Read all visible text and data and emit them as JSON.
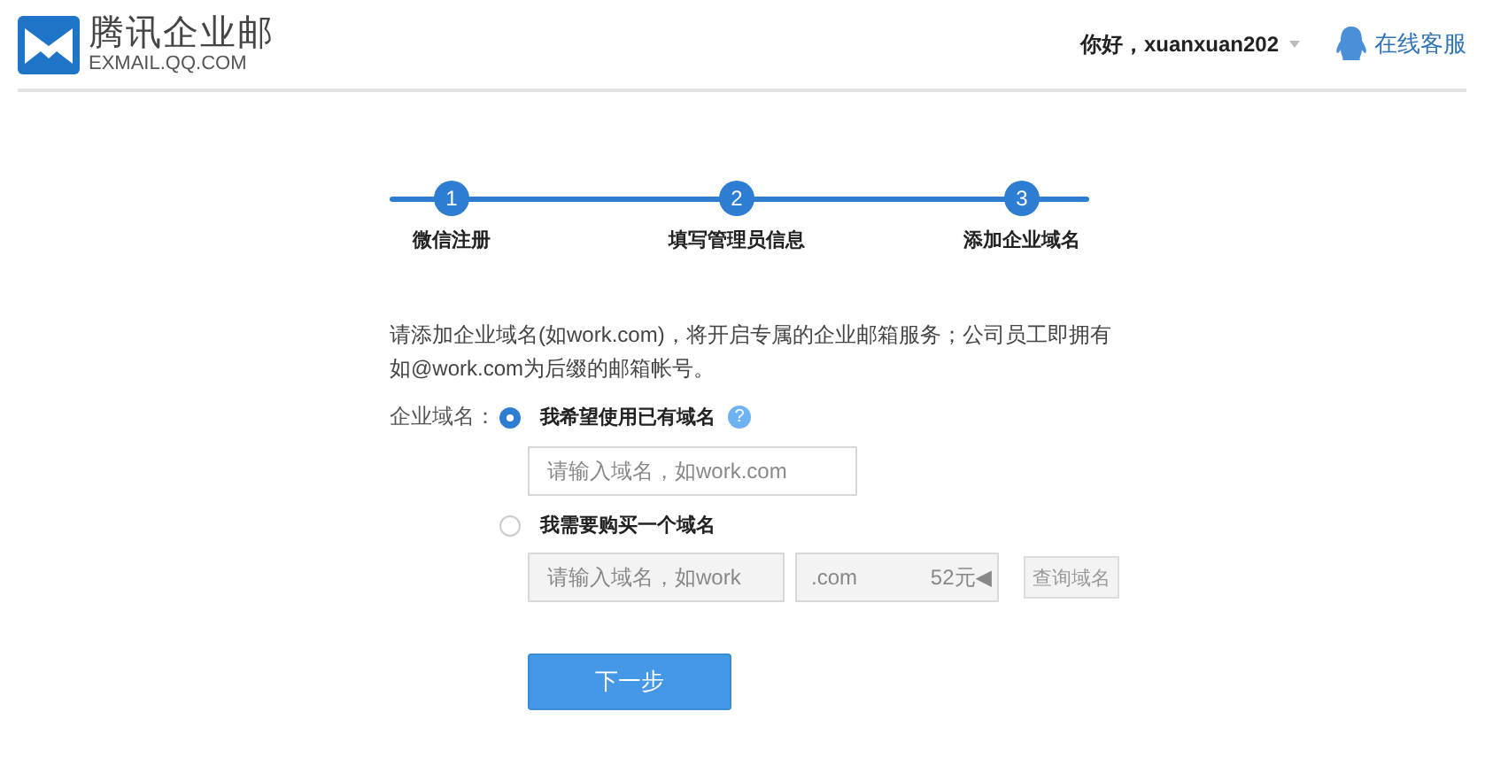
{
  "header": {
    "brand": "腾讯企业邮",
    "brand_sub": "EXMAIL.QQ.COM",
    "greeting": "你好，xuanxuan202",
    "support": "在线客服"
  },
  "steps": [
    {
      "number": "1",
      "label": "微信注册"
    },
    {
      "number": "2",
      "label": "填写管理员信息"
    },
    {
      "number": "3",
      "label": "添加企业域名"
    }
  ],
  "intro": "请添加企业域名(如work.com)，将开启专属的企业邮箱服务；公司员工即拥有如@work.com为后缀的邮箱帐号。",
  "field_label": "企业域名：",
  "options": [
    {
      "label": "我希望使用已有域名",
      "selected": true,
      "help": "?",
      "input": {
        "placeholder": "请输入域名，如work.com",
        "disabled": false
      }
    },
    {
      "label": "我需要购买一个域名",
      "selected": false,
      "input": {
        "placeholder": "请输入域名，如work",
        "disabled": true
      },
      "suffix": {
        "value": ".com",
        "price": "52元",
        "arrow": "◀"
      },
      "query_button": "查询域名"
    }
  ],
  "next_button": "下一步"
}
